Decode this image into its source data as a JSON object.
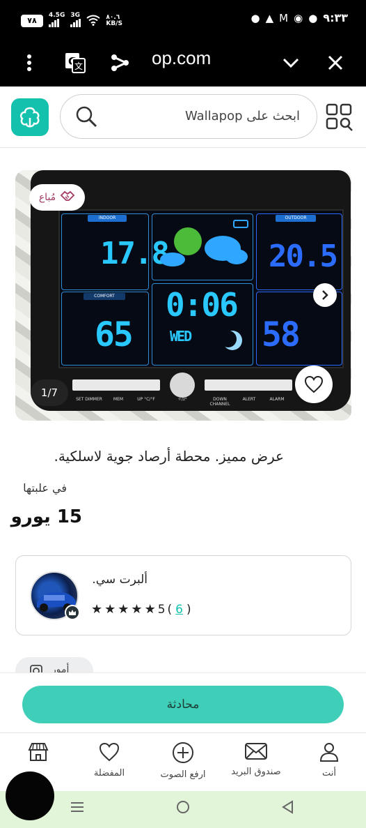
{
  "status_bar": {
    "battery": "٧٨",
    "net1": "4.5G",
    "net2": "3G",
    "speed_value": "٨٠.٦",
    "speed_unit": "KB/S",
    "time": "٩:٣٣"
  },
  "browser": {
    "url": "op.com"
  },
  "header": {
    "search_placeholder": "ابحث على Wallapop"
  },
  "listing": {
    "sold_badge": "مُباع",
    "photo_counter": "1/7",
    "title": "عرض مميز. محطة أرصاد جوية لاسلكية.",
    "condition": "في علبتها",
    "price": "15 يورو"
  },
  "device_display": {
    "indoor_tag": "INDOOR",
    "outdoor_tag": "OUTDOOR",
    "comfort_tag": "COMFORT",
    "indoor_temp": "17.8",
    "outdoor_temp": "20.5",
    "indoor_humidity": "65",
    "outdoor_humidity": "58",
    "clock": "0:06",
    "day": "WED",
    "buttons": [
      "SET DIMMER",
      "MEM",
      "UP °C/°F",
      "☼/z²",
      "DOWN CHANNEL",
      "ALERT",
      "ALARM"
    ]
  },
  "seller": {
    "name": "ألبرت سي.",
    "rating": "5",
    "reviews": "6"
  },
  "chip": {
    "label": "أمور"
  },
  "actions": {
    "chat_label": "محادثة"
  },
  "tabbar": {
    "home": "",
    "favorites": "المفضلة",
    "upload": "ارفع الصوت",
    "inbox": "صندوق البريد",
    "you": "أنت"
  },
  "colors": {
    "brand": "#13c1ac",
    "chat_button": "#3fcfb9",
    "sold_badge_text": "#a23a63",
    "nav_bar": "#e3f5d8"
  }
}
